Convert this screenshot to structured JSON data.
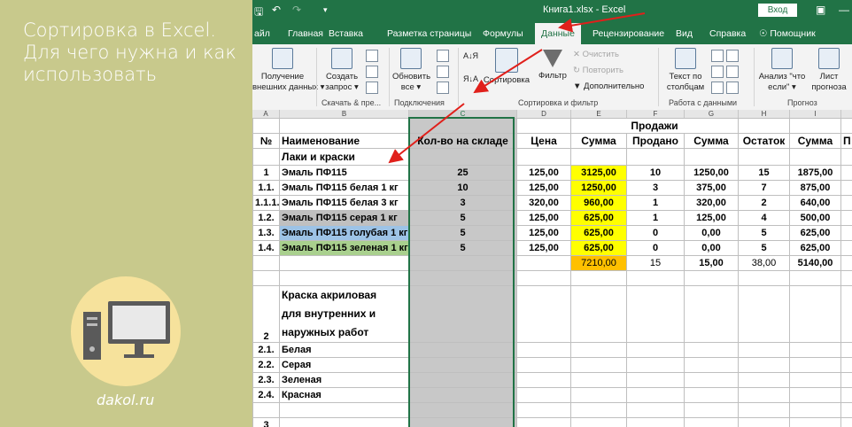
{
  "banner": {
    "title_lines": [
      "Сортировка в Excel.",
      "Для чего нужна и как",
      "использовать"
    ],
    "site": "dakol.ru"
  },
  "titlebar": {
    "title": "Книга1.xlsx  -  Excel",
    "login": "Вход"
  },
  "tabs": [
    "айл",
    "Главная",
    "Вставка",
    "Разметка страницы",
    "Формулы",
    "Данные",
    "Рецензирование",
    "Вид",
    "Справка",
    "Помощник"
  ],
  "active_tab": "Данные",
  "ribbon": {
    "get_data": [
      "Получение",
      "внешних данных"
    ],
    "create_query": [
      "Создать",
      "запрос"
    ],
    "refresh_all": [
      "Обновить",
      "все"
    ],
    "sort_az": "Сортировка",
    "filter": "Фильтр",
    "clear": "Очистить",
    "reapply": "Повторить",
    "advanced": "Дополнительно",
    "text_to_columns": [
      "Текст по",
      "столбцам"
    ],
    "whatif": [
      "Анализ \"что",
      "если\""
    ],
    "forecast_sheet": [
      "Лист",
      "прогноза"
    ],
    "groups": [
      "Скачать & пре...",
      "Подключения",
      "Сортировка и фильтр",
      "Работа с данными",
      "Прогноз"
    ]
  },
  "columns": [
    "A",
    "B",
    "C",
    "D",
    "E",
    "F",
    "G",
    "H",
    "I"
  ],
  "sheet": {
    "sales_header": "Продажи",
    "headers": [
      "№",
      "Наименование",
      "Кол-во на складе",
      "Цена",
      "Сумма",
      "Продано",
      "Сумма",
      "Остаток",
      "Сумма",
      "П"
    ],
    "group1": "Лаки и  краски",
    "rows": [
      [
        "1",
        "Эмаль ПФ115",
        "25",
        "125,00",
        "3125,00",
        "10",
        "1250,00",
        "15",
        "1875,00"
      ],
      [
        "1.1.",
        "Эмаль ПФ115 белая 1 кг",
        "10",
        "125,00",
        "1250,00",
        "3",
        "375,00",
        "7",
        "875,00"
      ],
      [
        "1.1.1.",
        "Эмаль ПФ115 белая 3 кг",
        "3",
        "320,00",
        "960,00",
        "1",
        "320,00",
        "2",
        "640,00"
      ],
      [
        "1.2.",
        "Эмаль ПФ115 серая 1 кг",
        "5",
        "125,00",
        "625,00",
        "1",
        "125,00",
        "4",
        "500,00"
      ],
      [
        "1.3.",
        "Эмаль ПФ115 голубая 1 кг",
        "5",
        "125,00",
        "625,00",
        "0",
        "0,00",
        "5",
        "625,00"
      ],
      [
        "1.4.",
        "Эмаль ПФ115 зеленая 1 кг",
        "5",
        "125,00",
        "625,00",
        "0",
        "0,00",
        "5",
        "625,00"
      ]
    ],
    "totals": [
      "7210,00",
      "15",
      "15,00",
      "38,00",
      "5140,00"
    ],
    "group2_lines": [
      "Краска акриловая",
      "для внутренних и",
      "наружных работ"
    ],
    "group2_num": "2",
    "sub": [
      [
        "2.1.",
        "Белая"
      ],
      [
        "2.2.",
        "Серая"
      ],
      [
        "2.3.",
        "Зеленая"
      ],
      [
        "2.4.",
        "Красная"
      ]
    ],
    "last_num": "3"
  },
  "colors": {
    "excel_green": "#217346",
    "banner": "#c8c98c",
    "arrow": "#e0201b",
    "highlight": "#ffff00",
    "total": "#ffc000"
  }
}
